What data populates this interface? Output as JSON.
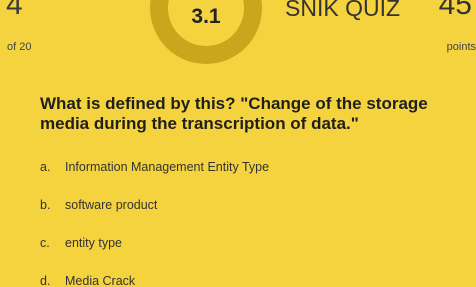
{
  "header": {
    "question_number": "4",
    "question_total": "of 20",
    "timer_value": "3.1",
    "quiz_title": "SNIK QUIZ",
    "score_value": "45",
    "score_label": "points"
  },
  "question": {
    "text": "What is defined by this? \"Change of the storage media during the transcription of data.\""
  },
  "answers": [
    {
      "letter": "a.",
      "label": "Information Management Entity Type"
    },
    {
      "letter": "b.",
      "label": "software product"
    },
    {
      "letter": "c.",
      "label": "entity type"
    },
    {
      "letter": "d.",
      "label": "Media Crack"
    }
  ],
  "colors": {
    "background": "#f5d33f",
    "timer_ring": "#c9a61c",
    "text": "#222222"
  }
}
